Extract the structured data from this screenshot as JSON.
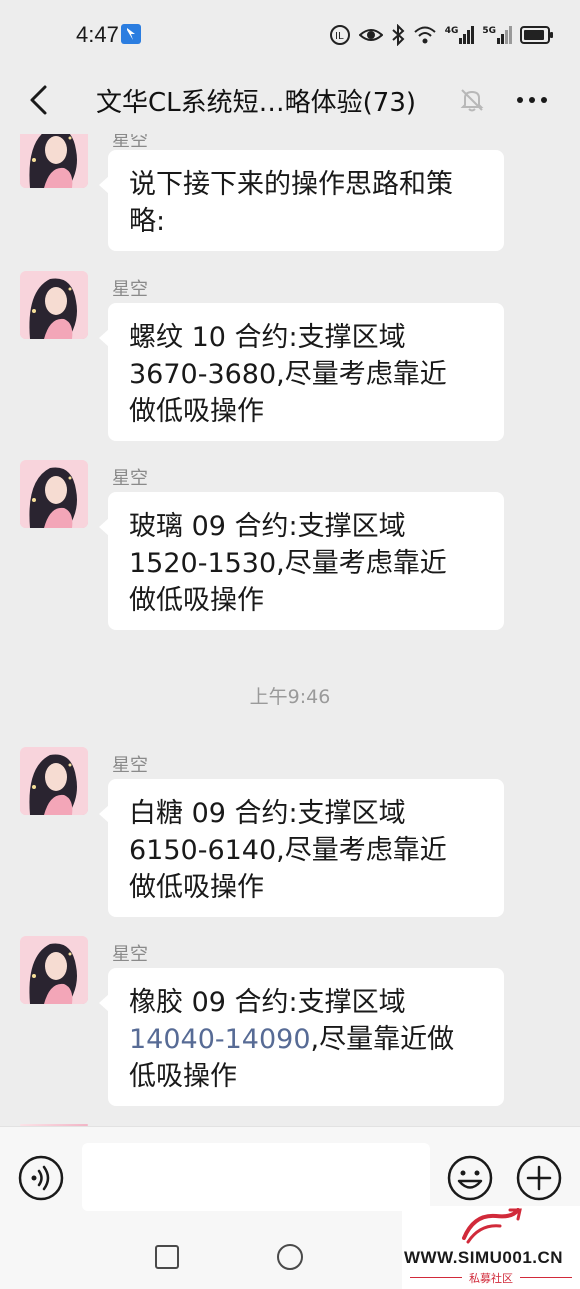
{
  "status_bar": {
    "time": "4:47",
    "network_1": "4G",
    "network_2": "5G"
  },
  "header": {
    "title": "文华CL系统短…略体验(73)"
  },
  "messages": [
    {
      "sender": "星空",
      "text": "说下接下来的操作思路和策略:"
    },
    {
      "sender": "星空",
      "line1": "螺纹 10 合约:支撑区域",
      "line2": "3670-3680,尽量考虑靠近",
      "line3": "做低吸操作"
    },
    {
      "sender": "星空",
      "line1": "玻璃 09 合约:支撑区域",
      "line2": "1520-1530,尽量考虑靠近",
      "line3": "做低吸操作"
    },
    {
      "sender": "星空",
      "line1": "白糖 09 合约:支撑区域",
      "line2": "6150-6140,尽量考虑靠近",
      "line3": "做低吸操作"
    },
    {
      "sender": "星空",
      "line1": "橡胶 09 合约:支撑区域",
      "range": "14040-14090",
      "line2_rest": ",尽量靠近做",
      "line3": "低吸操作"
    }
  ],
  "timestamp": "上午9:46",
  "watermark": {
    "url": "WWW.SIMU001.CN",
    "sub": "私募社区"
  },
  "colors": {
    "background": "#ededed",
    "bubble": "#ffffff",
    "link": "#576b95"
  }
}
